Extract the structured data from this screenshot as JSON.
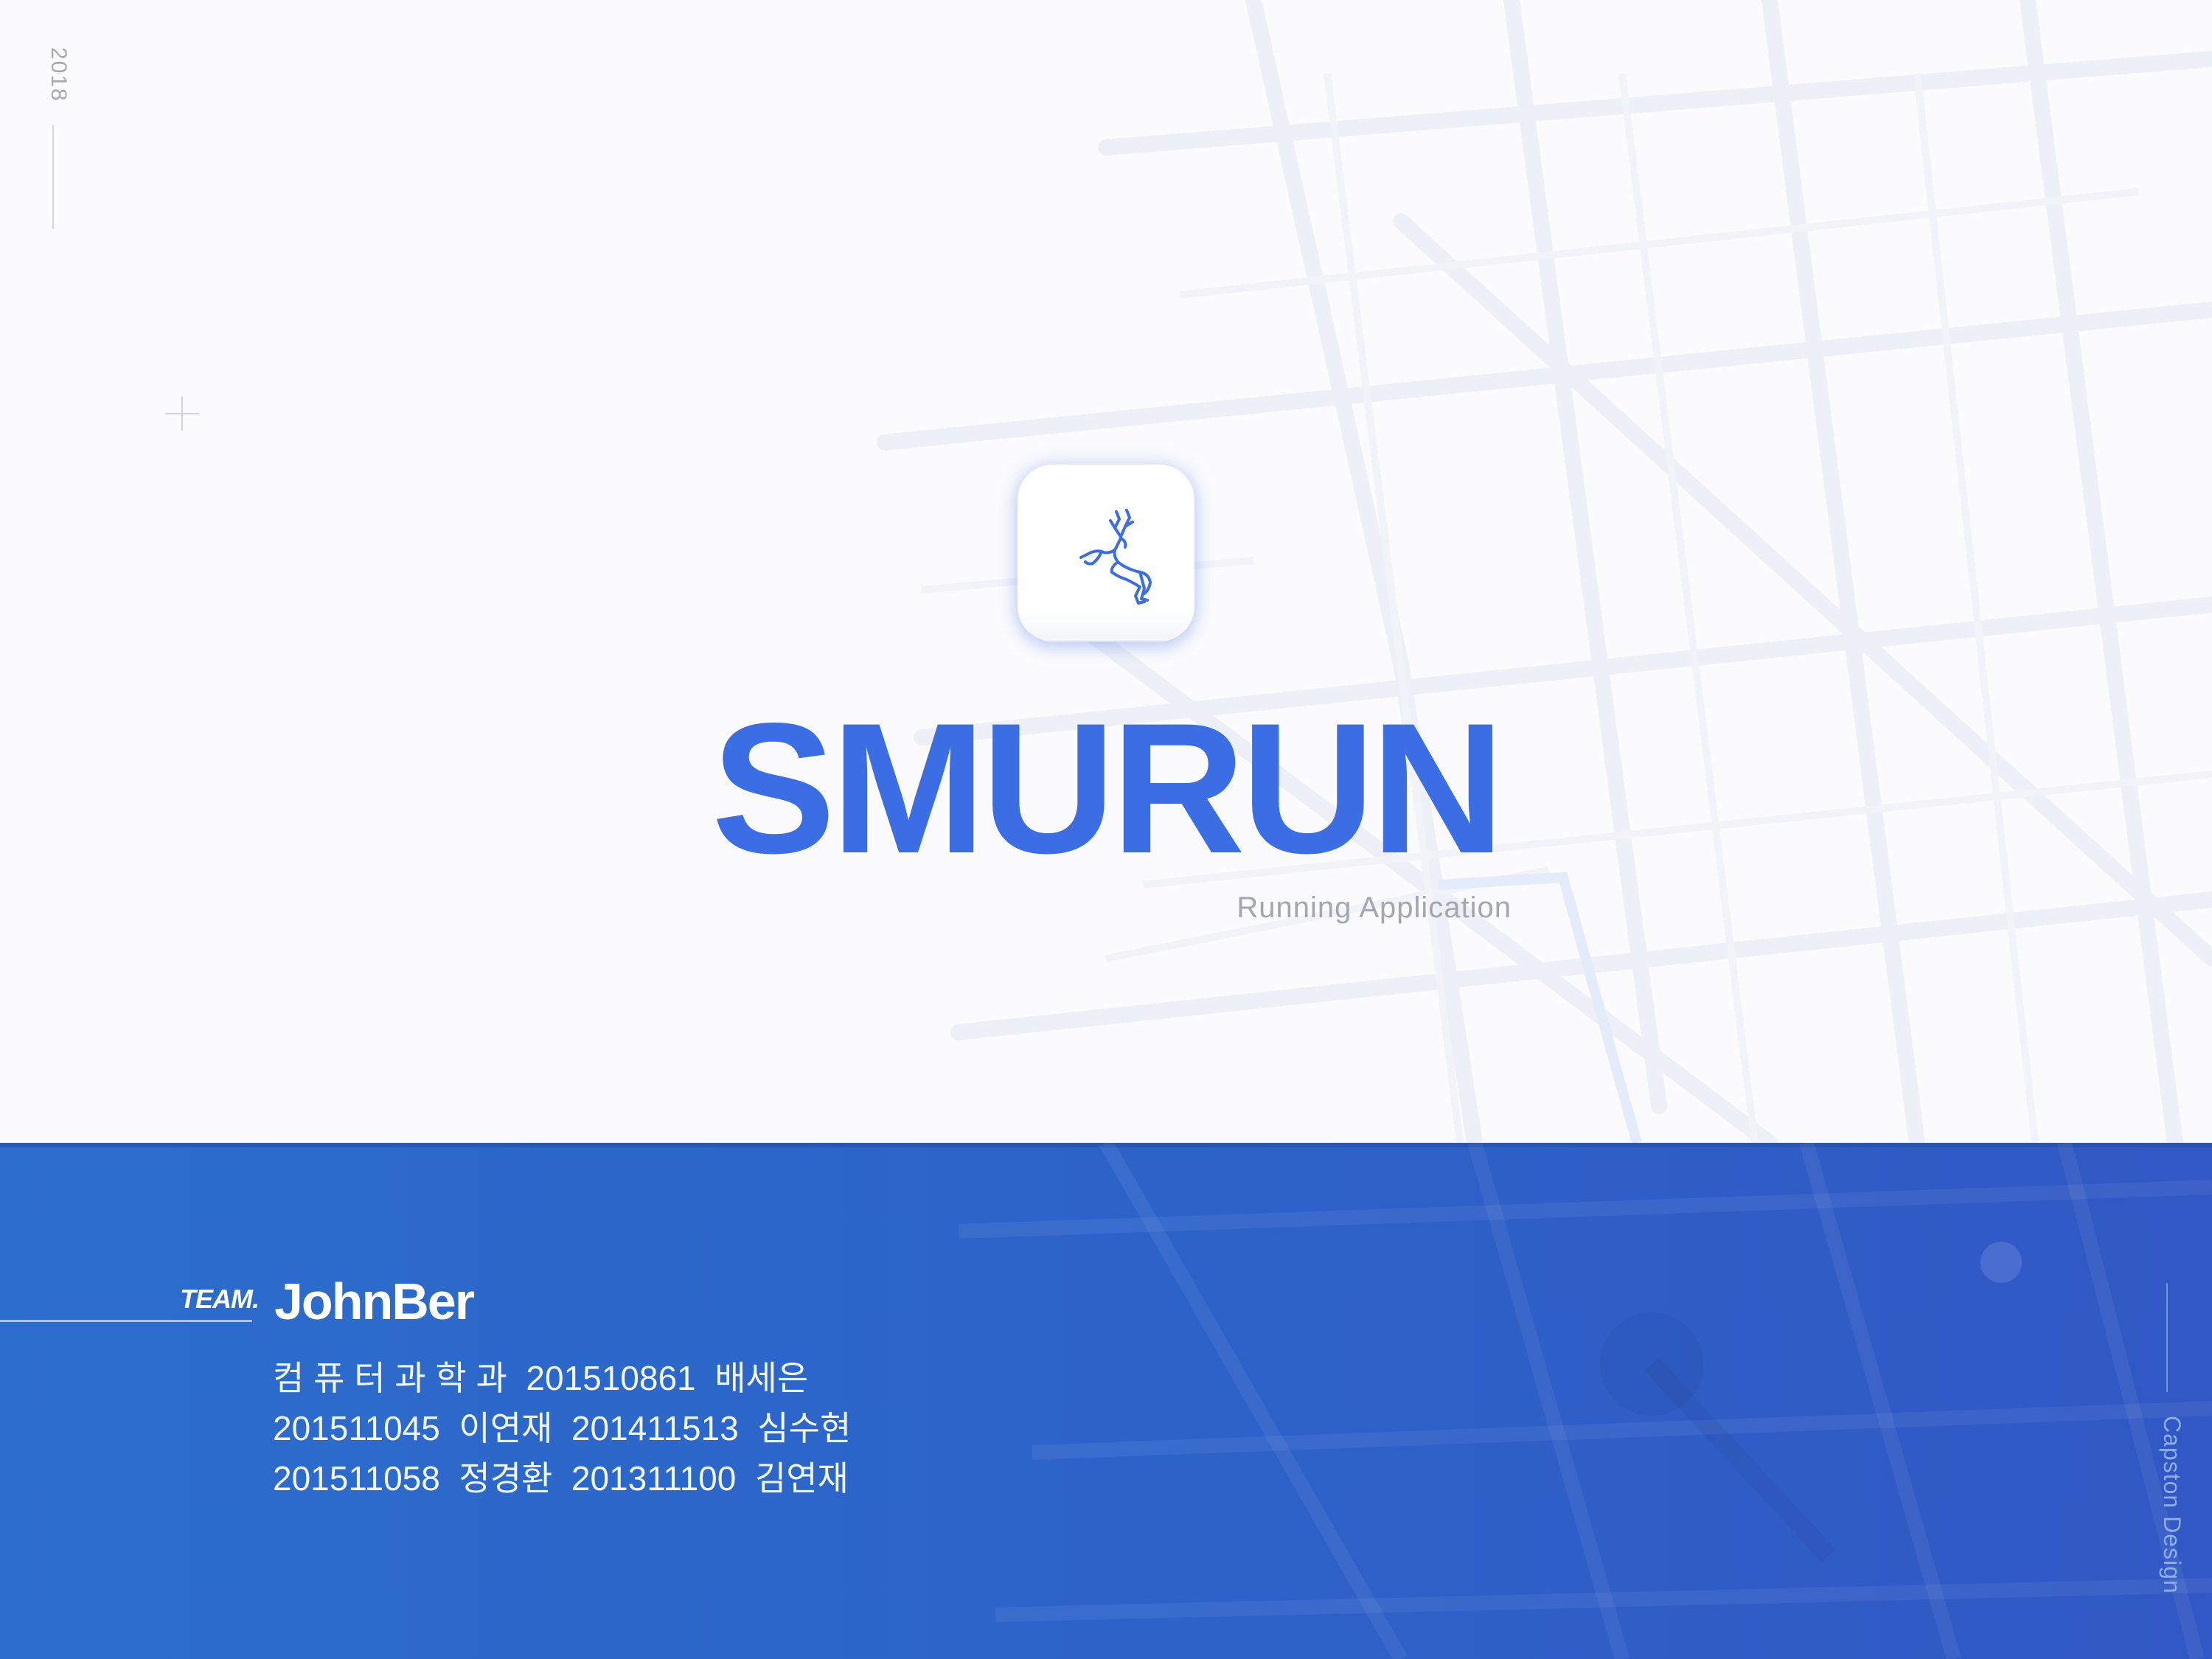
{
  "year": "2018",
  "title": "SMURUN",
  "subtitle": "Running Application",
  "team": {
    "label": "TEAM.",
    "name": "JohnBer",
    "members": [
      "컴 퓨 터 과 학 과  201510861  배세은",
      "201511045  이연재  201411513  심수현",
      "201511058  정경환  201311100  김연재"
    ]
  },
  "side_label": "Capston Design",
  "colors": {
    "accent": "#3b6ee4",
    "band": "#2d63c9",
    "text_muted": "#a3a6ae"
  },
  "icons": {
    "app_logo": "leaping-deer-icon"
  }
}
